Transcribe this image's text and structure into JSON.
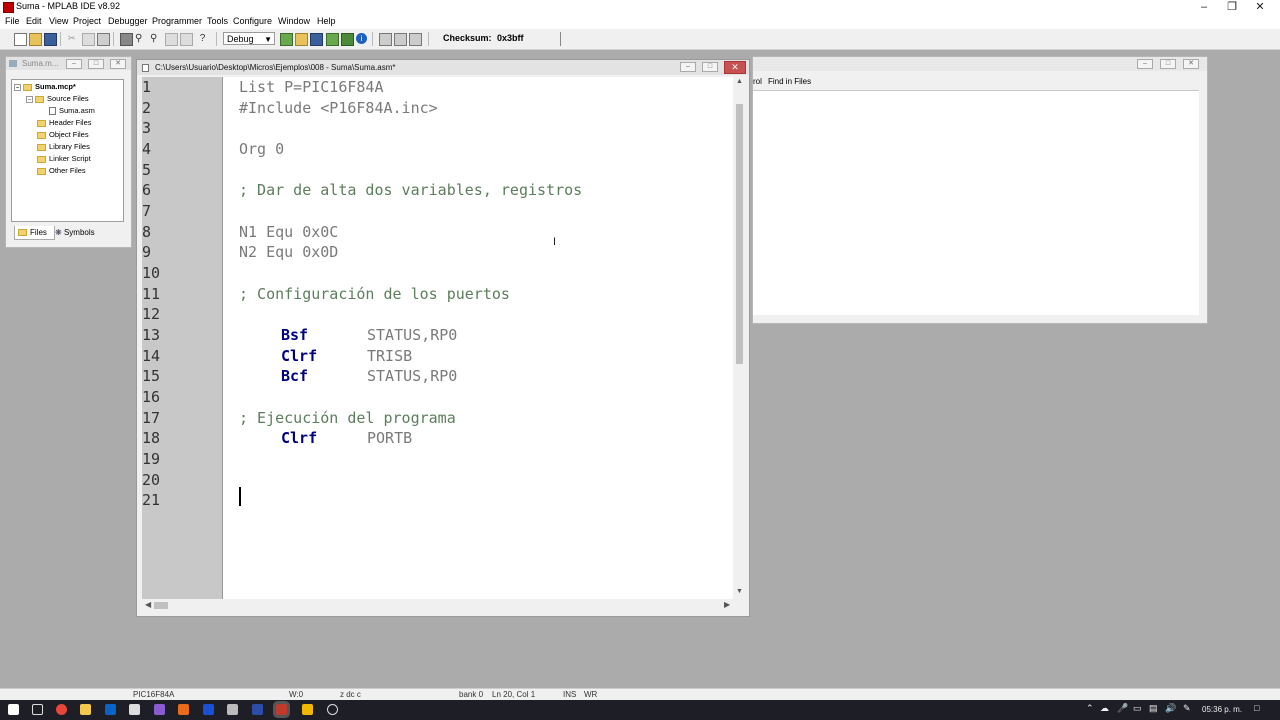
{
  "window": {
    "title": "Suma - MPLAB IDE v8.92"
  },
  "menu": [
    "File",
    "Edit",
    "View",
    "Project",
    "Debugger",
    "Programmer",
    "Tools",
    "Configure",
    "Window",
    "Help"
  ],
  "toolbar": {
    "config": "Debug",
    "checksum_label": "Checksum:",
    "checksum_value": "0x3bff"
  },
  "project": {
    "title": "Suma.m...",
    "root": "Suma.mcp*",
    "source_folder": "Source Files",
    "source_file": "Suma.asm",
    "folders": [
      "Header Files",
      "Object Files",
      "Library Files",
      "Linker Script",
      "Other Files"
    ],
    "tabs": [
      "Files",
      "Symbols"
    ]
  },
  "output": {
    "tabs": [
      "rol",
      "Find in Files"
    ]
  },
  "editor": {
    "path": "C:\\Users\\Usuario\\Desktop\\Micros\\Ejemplos\\008 - Suma\\Suma.asm*",
    "line_numbers": [
      "1",
      "2",
      "3",
      "4",
      "5",
      "6",
      "7",
      "8",
      "9",
      "10",
      "11",
      "12",
      "13",
      "14",
      "15",
      "16",
      "17",
      "18",
      "19",
      "20",
      "21"
    ],
    "lines": {
      "l1": "List P=PIC16F84A",
      "l2": "#Include <P16F84A.inc>",
      "l4": "Org 0",
      "l6": "; Dar de alta dos variables, registros",
      "l8": "N1 Equ 0x0C",
      "l9": "N2 Equ 0x0D",
      "l11": "; Configuración de los puertos",
      "l13_kw": "Bsf",
      "l13_op": "STATUS,RP0",
      "l14_kw": "Clrf",
      "l14_op": "TRISB",
      "l15_kw": "Bcf",
      "l15_op": "STATUS,RP0",
      "l17": "; Ejecución del programa",
      "l18_kw": "Clrf",
      "l18_op": "PORTB"
    }
  },
  "status": {
    "device": "PIC16F84A",
    "w": "W:0",
    "flags": "z dc c",
    "bank": "bank 0",
    "position": "Ln 20, Col 1",
    "ins": "INS",
    "wr": "WR"
  },
  "taskbar": {
    "time": "05:36 p. m."
  },
  "colors": {
    "keyword": "#000080",
    "comment": "#5c7e5c",
    "directive": "#7a7a7a",
    "gutter": "#c8c8c8"
  }
}
